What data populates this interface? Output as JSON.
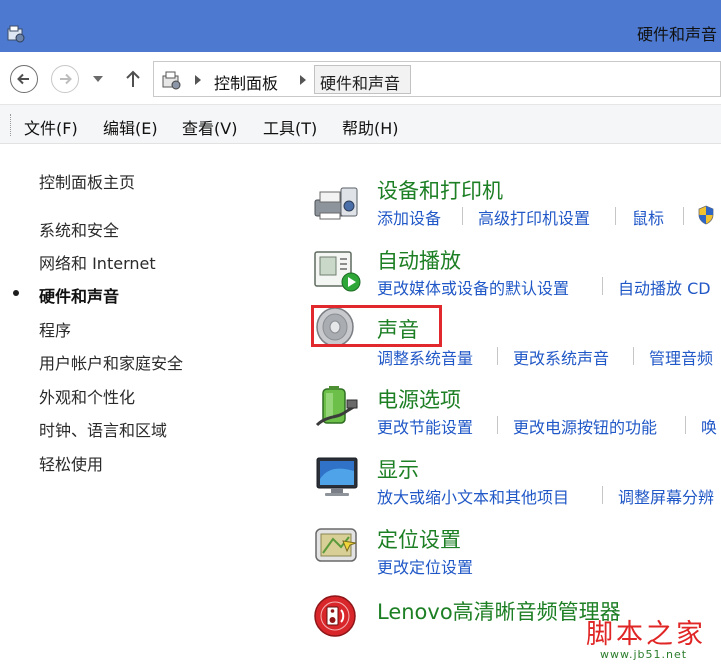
{
  "window": {
    "title": "硬件和声音"
  },
  "address_bar": {
    "breadcrumbs": [
      "控制面板",
      "硬件和声音"
    ]
  },
  "menu": {
    "items": [
      "文件(F)",
      "编辑(E)",
      "查看(V)",
      "工具(T)",
      "帮助(H)"
    ]
  },
  "sidebar": {
    "items": [
      {
        "label": "控制面板主页"
      },
      {
        "label": "系统和安全"
      },
      {
        "label": "网络和 Internet"
      },
      {
        "label": "硬件和声音",
        "current": true
      },
      {
        "label": "程序"
      },
      {
        "label": "用户帐户和家庭安全"
      },
      {
        "label": "外观和个性化"
      },
      {
        "label": "时钟、语言和区域"
      },
      {
        "label": "轻松使用"
      }
    ]
  },
  "categories": [
    {
      "title": "设备和打印机",
      "icon": "printer-icon",
      "links": [
        "添加设备",
        "高级打印机设置",
        "鼠标"
      ]
    },
    {
      "title": "自动播放",
      "icon": "autoplay-icon",
      "links": [
        "更改媒体或设备的默认设置",
        "自动播放 CD"
      ]
    },
    {
      "title": "声音",
      "icon": "speaker-icon",
      "links": [
        "调整系统音量",
        "更改系统声音",
        "管理音频"
      ]
    },
    {
      "title": "电源选项",
      "icon": "battery-icon",
      "links": [
        "更改节能设置",
        "更改电源按钮的功能",
        "唤"
      ]
    },
    {
      "title": "显示",
      "icon": "monitor-icon",
      "links": [
        "放大或缩小文本和其他项目",
        "调整屏幕分辨"
      ]
    },
    {
      "title": "定位设置",
      "icon": "location-icon",
      "links": [
        "更改定位设置"
      ]
    },
    {
      "title": "Lenovo高清晰音频管理器",
      "icon": "audio-manager-icon",
      "links": []
    }
  ],
  "watermark": {
    "text": "脚本之家",
    "url": "www.jb51.net"
  },
  "colors": {
    "titlebar": "#4d7ad0",
    "category_title": "#1d7f24",
    "link": "#2158c7",
    "highlight_box": "#e0282d",
    "watermark": "#e02525"
  }
}
